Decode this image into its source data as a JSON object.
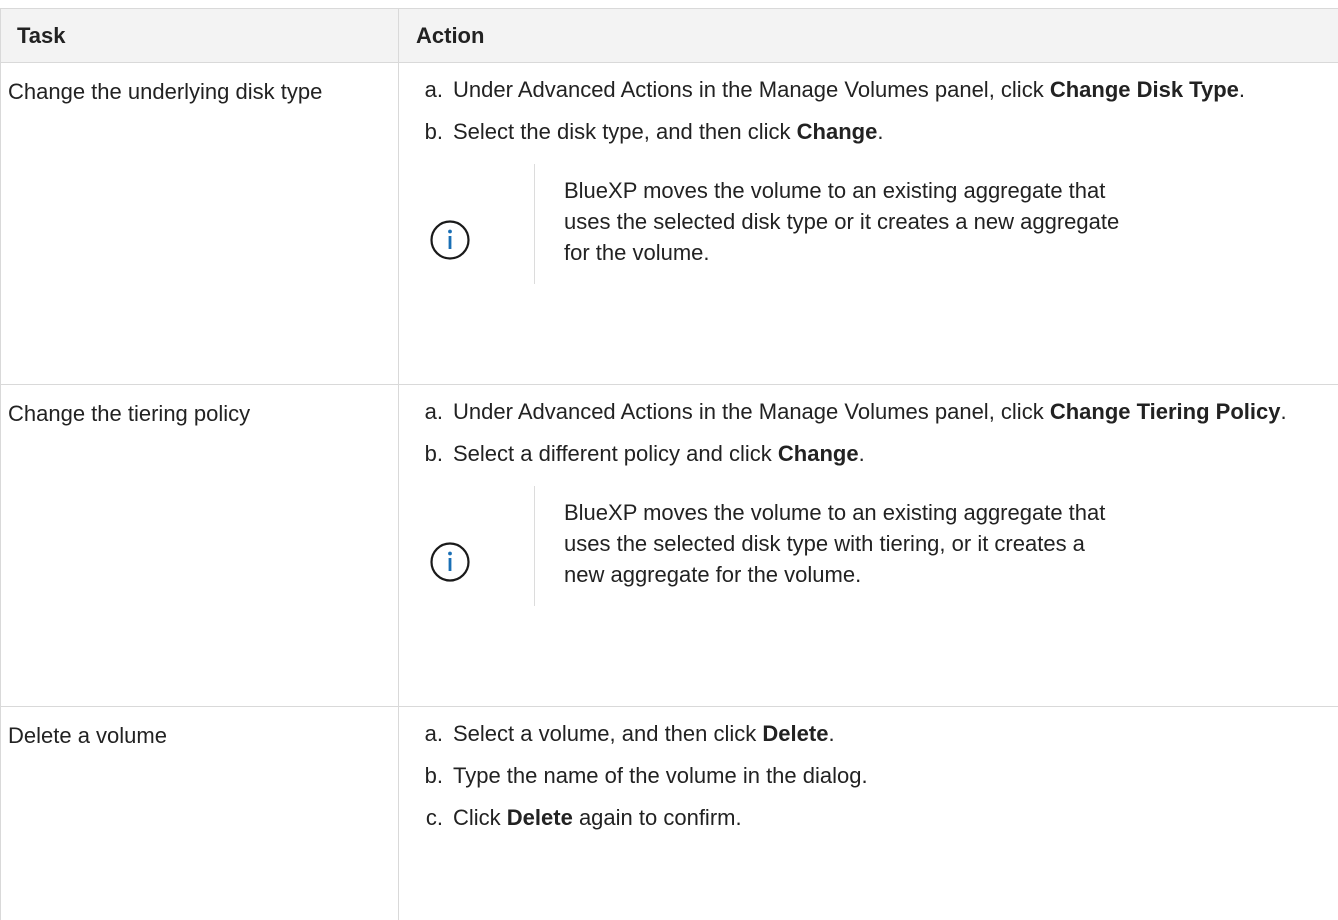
{
  "header": {
    "task": "Task",
    "action": "Action"
  },
  "rows": [
    {
      "task": "Change the underlying disk type",
      "steps": [
        {
          "marker": "a.",
          "pre": "Under Advanced Actions in the Manage Volumes panel, click ",
          "bold": "Change Disk Type",
          "post": "."
        },
        {
          "marker": "b.",
          "pre": "Select the disk type, and then click ",
          "bold": "Change",
          "post": "."
        }
      ],
      "note": "BlueXP moves the volume to an existing aggregate that uses the selected disk type or it creates a new aggregate for the volume."
    },
    {
      "task": "Change the tiering policy",
      "steps": [
        {
          "marker": "a.",
          "pre": "Under Advanced Actions in the Manage Volumes panel, click ",
          "bold": "Change Tiering Policy",
          "post": "."
        },
        {
          "marker": "b.",
          "pre": "Select a different policy and click ",
          "bold": "Change",
          "post": "."
        }
      ],
      "note": "BlueXP moves the volume to an existing aggregate that uses the selected disk type with tiering, or it creates a new aggregate for the volume."
    },
    {
      "task": "Delete a volume",
      "steps": [
        {
          "marker": "a.",
          "pre": "Select a volume, and then click ",
          "bold": "Delete",
          "post": "."
        },
        {
          "marker": "b.",
          "pre": "Type the name of the volume in the dialog.",
          "bold": "",
          "post": ""
        },
        {
          "marker": "c.",
          "pre": "Click ",
          "bold": "Delete",
          "post": " again to confirm."
        }
      ]
    }
  ],
  "colors": {
    "text": "#222222",
    "header_bg": "#f3f3f3",
    "border": "#d9d9d9",
    "info_icon": "#1a6fb5"
  },
  "icons": {
    "note_icon": "info-circle-icon"
  }
}
